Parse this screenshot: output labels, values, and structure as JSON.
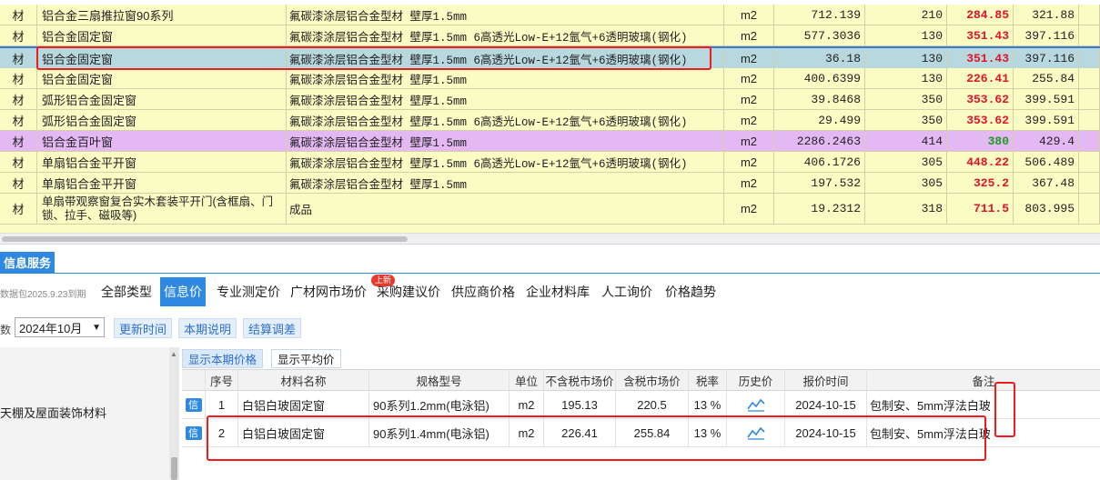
{
  "materials": [
    {
      "type": "材",
      "name": "铝合金三扇推拉窗90系列",
      "spec": "氟碳漆涂层铝合金型材 壁厚1.5mm",
      "unit": "m2",
      "qty": "712.139",
      "tax": "210",
      "price": "284.85",
      "price_color": "#e2132a",
      "market": "321.88"
    },
    {
      "type": "材",
      "name": "铝合金固定窗",
      "spec": "氟碳漆涂层铝合金型材 壁厚1.5mm 6高透光Low-E+12氩气+6透明玻璃(钢化)",
      "unit": "m2",
      "qty": "577.3036",
      "tax": "130",
      "price": "351.43",
      "price_color": "#e2132a",
      "market": "397.116"
    },
    {
      "type": "材",
      "name": "铝合金固定窗",
      "spec": "氟碳漆涂层铝合金型材 壁厚1.5mm 6高透光Low-E+12氩气+6透明玻璃(钢化)",
      "unit": "m2",
      "qty": "36.18",
      "tax": "130",
      "price": "351.43",
      "price_color": "#e2132a",
      "market": "397.116"
    },
    {
      "type": "材",
      "name": "铝合金固定窗",
      "spec": "氟碳漆涂层铝合金型材 壁厚1.5mm",
      "unit": "m2",
      "qty": "400.6399",
      "tax": "130",
      "price": "226.41",
      "price_color": "#e2132a",
      "market": "255.84"
    },
    {
      "type": "材",
      "name": "弧形铝合金固定窗",
      "spec": "氟碳漆涂层铝合金型材 壁厚1.5mm",
      "unit": "m2",
      "qty": "39.8468",
      "tax": "350",
      "price": "353.62",
      "price_color": "#e2132a",
      "market": "399.591"
    },
    {
      "type": "材",
      "name": "弧形铝合金固定窗",
      "spec": "氟碳漆涂层铝合金型材 壁厚1.5mm 6高透光Low-E+12氩气+6透明玻璃(钢化)",
      "unit": "m2",
      "qty": "29.499",
      "tax": "350",
      "price": "353.62",
      "price_color": "#e2132a",
      "market": "399.591"
    },
    {
      "type": "材",
      "name": "铝合金百叶窗",
      "spec": "氟碳漆涂层铝合金型材 壁厚1.5mm",
      "unit": "m2",
      "qty": "2286.2463",
      "tax": "414",
      "price": "380",
      "price_color": "#1f9a1f",
      "market": "429.4"
    },
    {
      "type": "材",
      "name": "单扇铝合金平开窗",
      "spec": "氟碳漆涂层铝合金型材 壁厚1.5mm 6高透光Low-E+12氩气+6透明玻璃(钢化)",
      "unit": "m2",
      "qty": "406.1726",
      "tax": "305",
      "price": "448.22",
      "price_color": "#e2132a",
      "market": "506.489"
    },
    {
      "type": "材",
      "name": "单扇铝合金平开窗",
      "spec": "氟碳漆涂层铝合金型材 壁厚1.5mm",
      "unit": "m2",
      "qty": "197.532",
      "tax": "305",
      "price": "325.2",
      "price_color": "#e2132a",
      "market": "367.48"
    },
    {
      "type": "材",
      "name": "单扇带观察窗复合实木套装平开门(含框扇、门锁、拉手、磁吸等)",
      "spec": "成品",
      "unit": "m2",
      "qty": "19.2312",
      "tax": "318",
      "price": "711.5",
      "price_color": "#e2132a",
      "market": "803.995"
    }
  ],
  "panel": {
    "service_tab": "信息服务",
    "expire_note": "数据包2025.9.23到期",
    "categories": [
      "全部类型",
      "信息价",
      "专业测定价",
      "广材网市场价",
      "采购建议价",
      "供应商价格",
      "企业材料库",
      "人工询价",
      "价格趋势"
    ],
    "new_badge": "上新",
    "period_label": "数",
    "period_value": "2024年10月",
    "btn_update_time": "更新时间",
    "btn_period_note": "本期说明",
    "btn_settle": "结算调差",
    "tree_item": "天棚及屋面装饰材料",
    "sub_tab_current": "显示本期价格",
    "sub_tab_avg": "显示平均价"
  },
  "price_table": {
    "headers": {
      "seq": "序号",
      "name": "材料名称",
      "spec": "规格型号",
      "unit": "单位",
      "pre_tax": "不含税市场价",
      "post_tax": "含税市场价",
      "rate": "税率",
      "history": "历史价",
      "time": "报价时间",
      "note": "备注"
    },
    "rows": [
      {
        "info": "信",
        "seq": "1",
        "name": "白铝白玻固定窗",
        "spec": "90系列1.2mm(电泳铝)",
        "unit": "m2",
        "pre_tax": "195.13",
        "post_tax": "220.5",
        "rate": "13 %",
        "time": "2024-10-15",
        "note": "包制安、5mm浮法白玻"
      },
      {
        "info": "信",
        "seq": "2",
        "name": "白铝白玻固定窗",
        "spec": "90系列1.4mm(电泳铝)",
        "unit": "m2",
        "pre_tax": "226.41",
        "post_tax": "255.84",
        "rate": "13 %",
        "time": "2024-10-15",
        "note": "包制安、5mm浮法白玻"
      }
    ]
  },
  "colors": {
    "accent": "#2f89e0",
    "row_yellow": "#fbfbc4",
    "row_purple": "#e4b8f3",
    "row_selected": "#b8d8e0",
    "annotation": "#ee1c1c"
  }
}
